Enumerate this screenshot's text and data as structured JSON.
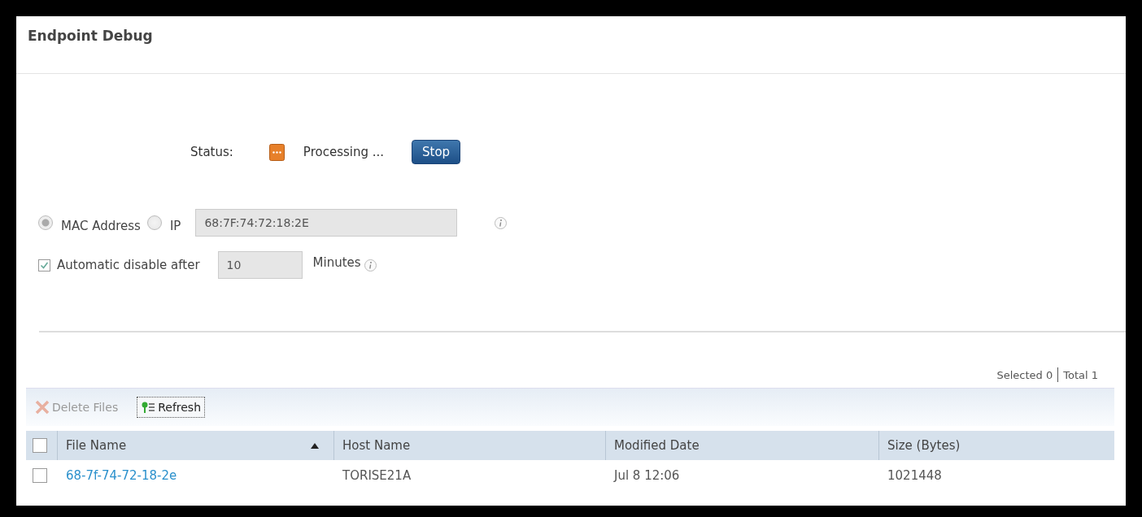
{
  "title": "Endpoint Debug",
  "status": {
    "label": "Status:",
    "text": "Processing ...",
    "button": "Stop"
  },
  "address_modes": [
    {
      "label": "MAC Address",
      "selected": true
    },
    {
      "label": "IP",
      "selected": false
    }
  ],
  "address_value": "68:7F:74:72:18:2E",
  "auto_disable": {
    "label": "Automatic disable after",
    "checked": true,
    "value": "10",
    "unit": "Minutes"
  },
  "summary": {
    "selected": "Selected 0",
    "total": "Total 1"
  },
  "toolbar": [
    {
      "kind": "delete",
      "label": "Delete Files",
      "disabled": true
    },
    {
      "kind": "refresh",
      "label": "Refresh",
      "disabled": false
    }
  ],
  "table": {
    "select_all": false,
    "columns": [
      {
        "label": "File Name",
        "sorted": true
      },
      {
        "label": "Host Name",
        "sorted": false
      },
      {
        "label": "Modified Date",
        "sorted": false
      },
      {
        "label": "Size (Bytes)",
        "sorted": false
      }
    ],
    "rows": [
      {
        "checked": false,
        "cells": [
          "68-7f-74-72-18-2e",
          "TORISE21A",
          "Jul 8 12:06",
          "1021448"
        ]
      }
    ]
  }
}
